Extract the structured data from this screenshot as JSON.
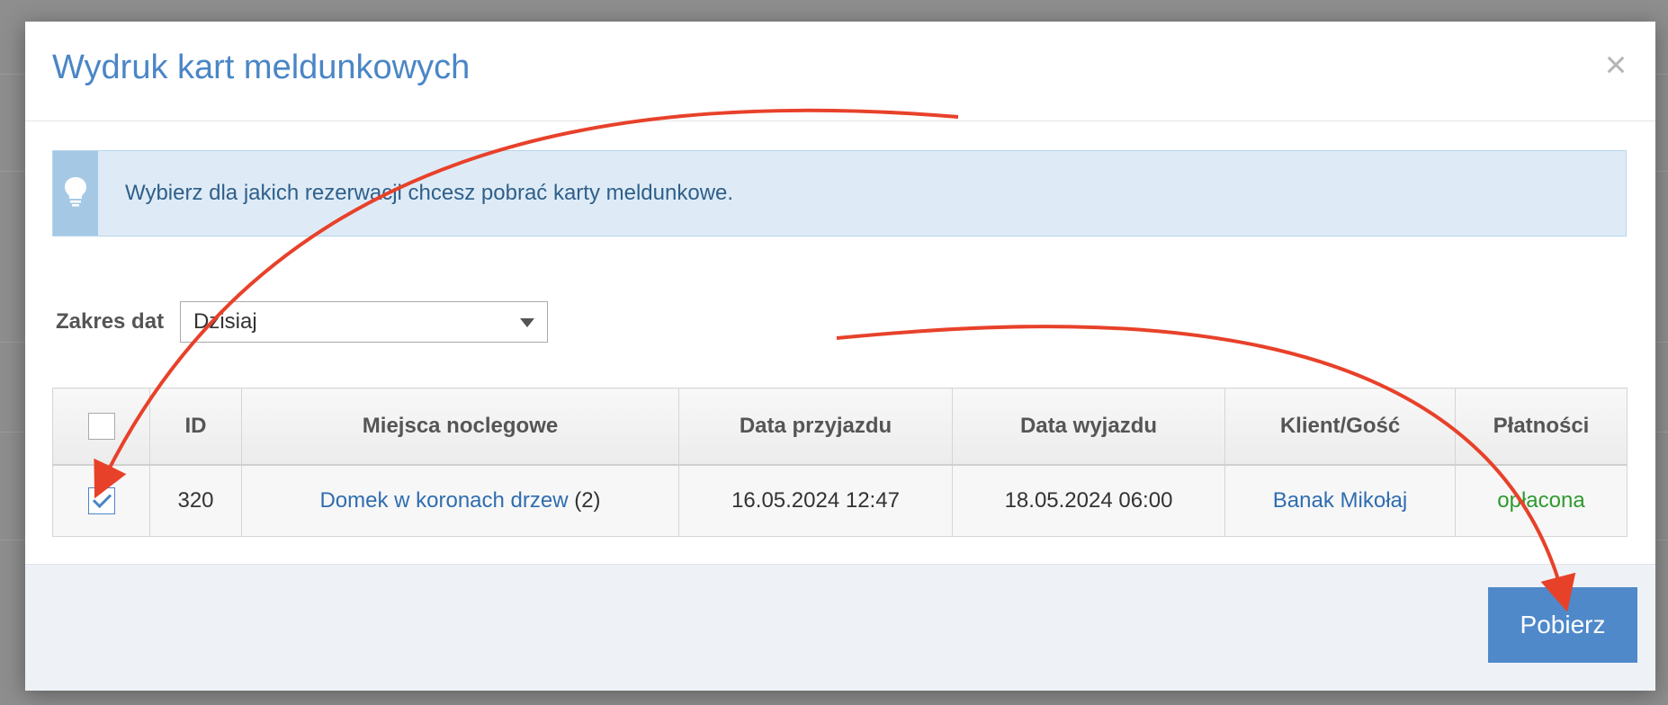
{
  "modal": {
    "title": "Wydruk kart meldunkowych",
    "close_glyph": "×"
  },
  "info": {
    "icon": "lightbulb-icon",
    "text": "Wybierz dla jakich rezerwacji chcesz pobrać karty meldunkowe."
  },
  "date_range": {
    "label": "Zakres dat",
    "selected": "Dzisiaj"
  },
  "table": {
    "headers": [
      "",
      "ID",
      "Miejsca noclegowe",
      "Data przyjazdu",
      "Data wyjazdu",
      "Klient/Gość",
      "Płatności"
    ],
    "rows": [
      {
        "checked": true,
        "id": "320",
        "place": "Domek w koronach drzew",
        "place_count": "(2)",
        "arrival": "16.05.2024 12:47",
        "departure": "18.05.2024 06:00",
        "client": "Banak Mikołaj",
        "payment": "opłacona"
      }
    ]
  },
  "footer": {
    "download_label": "Pobierz"
  },
  "colors": {
    "title": "#4a86c6",
    "button": "#4f89c9",
    "paid": "#2f9a2f",
    "annotation_arrow": "#e8412a"
  }
}
